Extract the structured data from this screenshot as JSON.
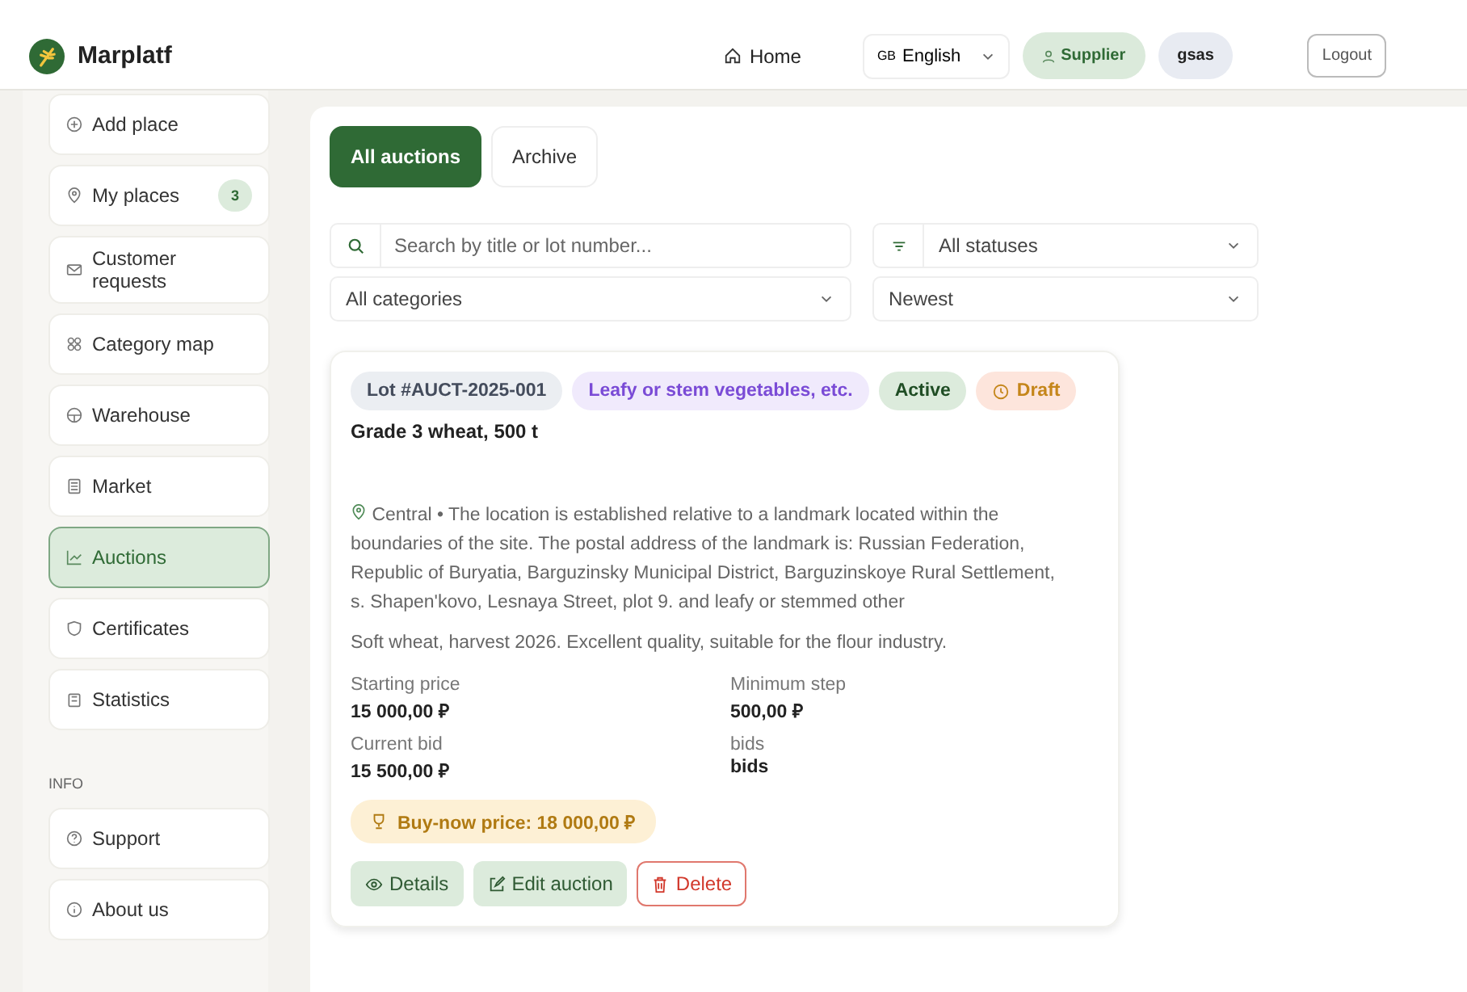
{
  "header": {
    "brand": "Marplatf",
    "nav": [
      {
        "label": "Home"
      }
    ],
    "language": {
      "flag": "GB",
      "value": "English"
    },
    "role": "Supplier",
    "user": "gsas",
    "logout": "Logout"
  },
  "sidebar": {
    "items": [
      {
        "label": "Add place",
        "selected": false
      },
      {
        "label": "My places",
        "selected": false,
        "count": "3"
      },
      {
        "label": "Customer requests",
        "selected": false
      },
      {
        "label": "Category map",
        "selected": false
      },
      {
        "label": "Warehouse",
        "selected": false
      },
      {
        "label": "Market",
        "selected": false
      },
      {
        "label": "Auctions",
        "selected": true
      },
      {
        "label": "Certificates",
        "selected": false
      },
      {
        "label": "Statistics",
        "selected": false
      }
    ],
    "section_title": "INFO",
    "info_items": [
      {
        "label": "Support",
        "selected": false
      },
      {
        "label": "About us",
        "selected": false
      }
    ]
  },
  "tabs": [
    {
      "label": "All auctions",
      "selected": true
    },
    {
      "label": "Archive",
      "selected": false
    }
  ],
  "filters": {
    "search": {
      "placeholder": "Search by title or lot number..."
    },
    "status": "All statuses",
    "category": "All categories",
    "sort": "Newest"
  },
  "auctions": [
    {
      "tags": [
        {
          "kind": "lot",
          "label": "Lot #AUCT-2025-001"
        },
        {
          "kind": "category",
          "label": "Leafy or stem vegetables, etc."
        },
        {
          "kind": "status",
          "label": "Active"
        },
        {
          "kind": "draft",
          "label": "Draft"
        }
      ],
      "title": "Grade 3 wheat, 500 t",
      "location": "Central • The location is established relative to a landmark located within the boundaries of the site. The postal address of the landmark is: Russian Federation, Republic of Buryatia, Barguzinsky Municipal District, Barguzinskoye Rural Settlement, s. Shapen'kovo, Lesnaya Street, plot 9. and leafy or stemmed other",
      "description": "Soft wheat, harvest 2026. Excellent quality, suitable for the flour industry.",
      "stats": [
        {
          "label": "Starting price",
          "value": "15 000,00 ₽"
        },
        {
          "label": "Minimum step",
          "value": "500,00 ₽"
        },
        {
          "label": "Current bid",
          "value": "15 500,00 ₽"
        },
        {
          "label": "bids",
          "value": "bids"
        }
      ],
      "buy_now": "Buy-now price: 18 000,00 ₽",
      "actions": [
        {
          "kind": "details",
          "label": "Details"
        },
        {
          "kind": "edit",
          "label": "Edit auction"
        },
        {
          "kind": "delete",
          "label": "Delete"
        }
      ]
    }
  ]
}
